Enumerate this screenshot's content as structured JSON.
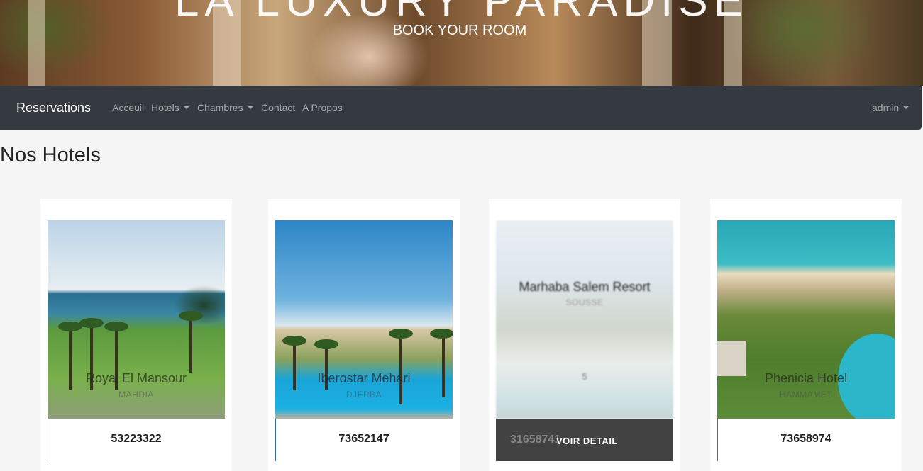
{
  "banner": {
    "big_title": "LA LUXURY PARADISE",
    "subtitle": "BOOK YOUR ROOM"
  },
  "navbar": {
    "brand": "Reservations",
    "links": {
      "acceuil": "Acceuil",
      "hotels": "Hotels",
      "chambres": "Chambres",
      "contact": "Contact",
      "apropos": "A Propos"
    },
    "user": "admin"
  },
  "page": {
    "title": "Nos Hotels"
  },
  "hotels": [
    {
      "name": "Royal El Mansour",
      "city": "MAHDIA",
      "phone": "53223322"
    },
    {
      "name": "Iberostar Mehari",
      "city": "DJERBA",
      "phone": "73652147"
    },
    {
      "name": "Marhaba Salem Resort",
      "city": "SOUSSE",
      "phone": "31658741",
      "rating": "5",
      "action": "VOIR DETAIL"
    },
    {
      "name": "Phenicia Hotel",
      "city": "HAMMAMET",
      "phone": "73658974"
    }
  ],
  "colors": {
    "navbar_bg": "#343a40",
    "page_bg": "#f5f5f5",
    "detail_bar_bg": "#424242"
  }
}
